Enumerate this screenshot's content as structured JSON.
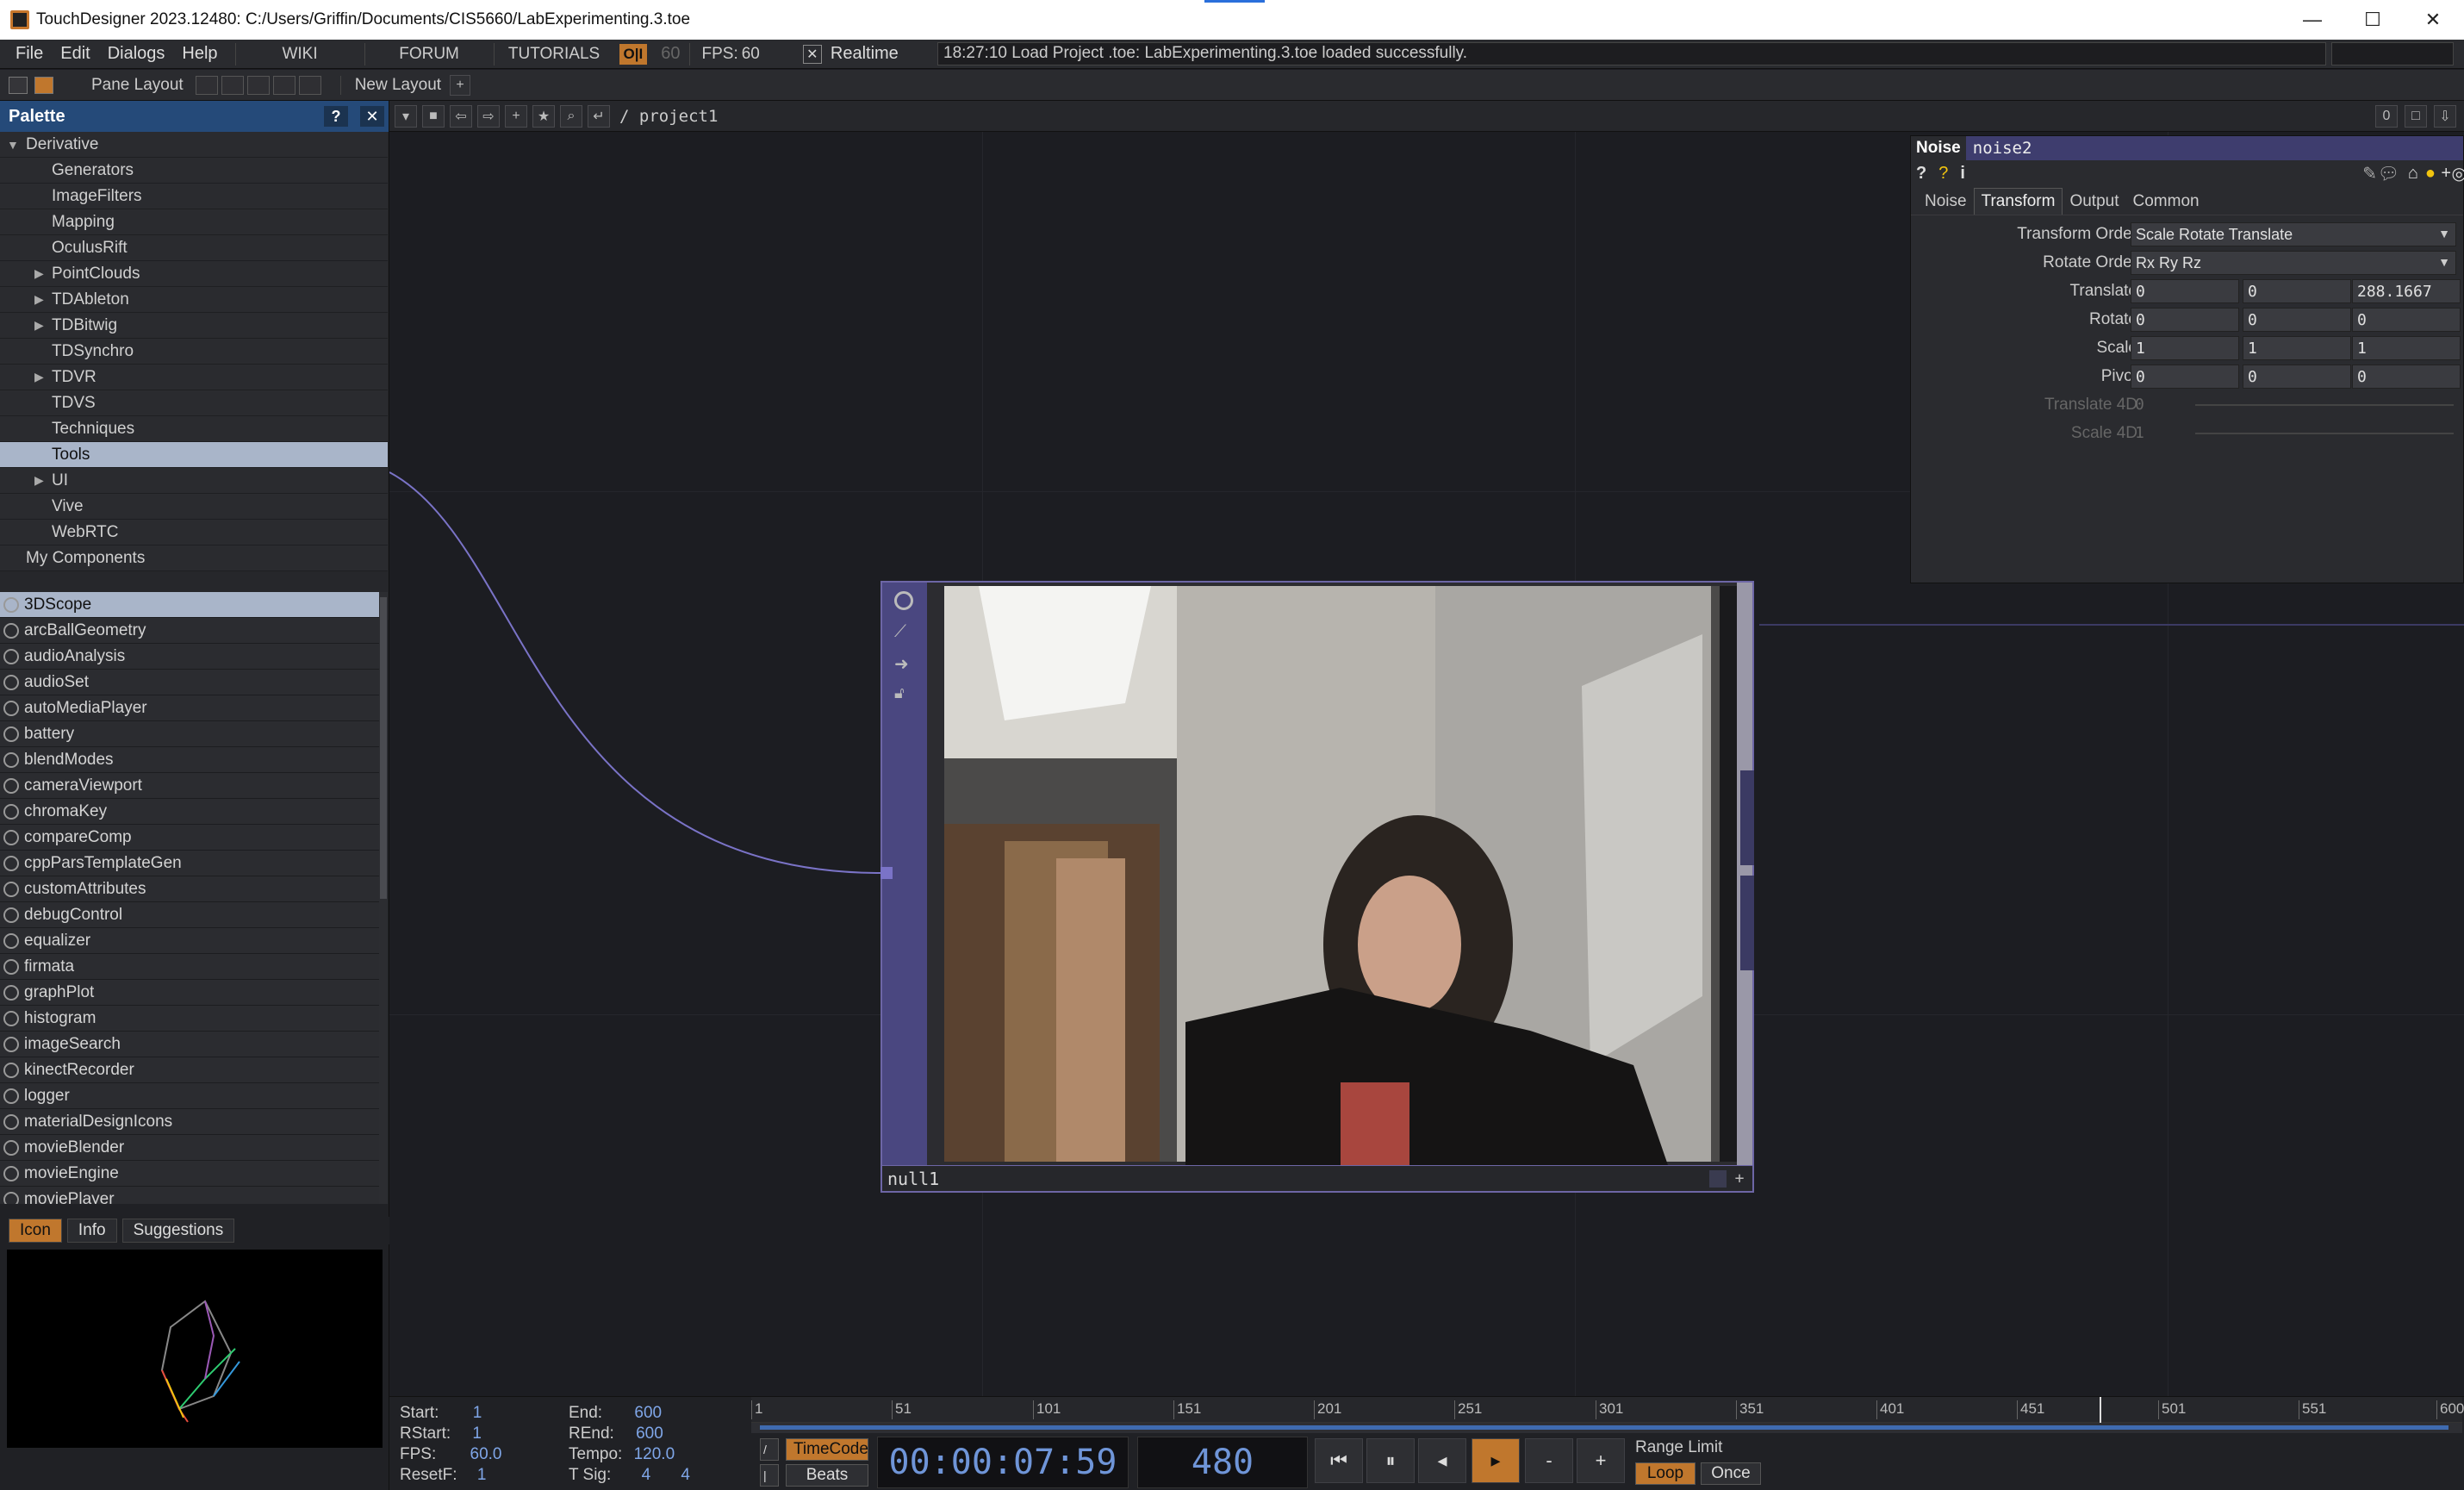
{
  "window": {
    "title": "TouchDesigner 2023.12480: C:/Users/Griffin/Documents/CIS5660/LabExperimenting.3.toe",
    "minimize": "—",
    "maximize": "☐",
    "close": "✕"
  },
  "menu": {
    "items": [
      "File",
      "Edit",
      "Dialogs",
      "Help"
    ],
    "wiki": "WIKI",
    "forum": "FORUM",
    "tutorials": "TUTORIALS",
    "oi": "O|I",
    "fps_cap": "60",
    "fps_label": "FPS:",
    "fps_value": "60",
    "realtime_check": "✕",
    "realtime": "Realtime",
    "status": "18:27:10 Load Project .toe: LabExperimenting.3.toe loaded successfully."
  },
  "toolbar2": {
    "pane_layout": "Pane Layout",
    "new_layout": "New Layout",
    "add": "+"
  },
  "palette": {
    "title": "Palette",
    "help": "?",
    "close": "✕",
    "tree": [
      {
        "label": "Derivative",
        "level": 0,
        "expanded": true
      },
      {
        "label": "Generators",
        "level": 1
      },
      {
        "label": "ImageFilters",
        "level": 1
      },
      {
        "label": "Mapping",
        "level": 1
      },
      {
        "label": "OculusRift",
        "level": 1
      },
      {
        "label": "PointClouds",
        "level": 1,
        "collapsed": true
      },
      {
        "label": "TDAbleton",
        "level": 1,
        "collapsed": true
      },
      {
        "label": "TDBitwig",
        "level": 1,
        "collapsed": true
      },
      {
        "label": "TDSynchro",
        "level": 1
      },
      {
        "label": "TDVR",
        "level": 1,
        "collapsed": true
      },
      {
        "label": "TDVS",
        "level": 1
      },
      {
        "label": "Techniques",
        "level": 1
      },
      {
        "label": "Tools",
        "level": 1,
        "selected": true
      },
      {
        "label": "UI",
        "level": 1,
        "collapsed": true
      },
      {
        "label": "Vive",
        "level": 1
      },
      {
        "label": "WebRTC",
        "level": 1
      },
      {
        "label": "My Components",
        "level": 0
      }
    ],
    "components": [
      "3DScope",
      "arcBallGeometry",
      "audioAnalysis",
      "audioSet",
      "autoMediaPlayer",
      "battery",
      "blendModes",
      "cameraViewport",
      "chromaKey",
      "compareComp",
      "cppParsTemplateGen",
      "customAttributes",
      "debugControl",
      "equalizer",
      "firmata",
      "graphPlot",
      "histogram",
      "imageSearch",
      "kinectRecorder",
      "logger",
      "materialDesignIcons",
      "movieBlender",
      "movieEngine",
      "moviePlayer"
    ],
    "selected_component": "3DScope",
    "tabs": [
      "Icon",
      "Info",
      "Suggestions"
    ],
    "active_tab": "Icon"
  },
  "network": {
    "path": "/ project1",
    "counter": "0",
    "node_name": "null1"
  },
  "params": {
    "op_type": "Noise",
    "op_name": "noise2",
    "tabs": [
      "Noise",
      "Transform",
      "Output",
      "Common"
    ],
    "active_tab": "Transform",
    "rows": [
      {
        "label": "Transform Order",
        "dropdown": "Scale Rotate Translate"
      },
      {
        "label": "Rotate Order",
        "dropdown": "Rx Ry Rz"
      },
      {
        "label": "Translate",
        "values": [
          "0",
          "0",
          "288.1667"
        ]
      },
      {
        "label": "Rotate",
        "values": [
          "0",
          "0",
          "0"
        ]
      },
      {
        "label": "Scale",
        "values": [
          "1",
          "1",
          "1"
        ]
      },
      {
        "label": "Pivot",
        "values": [
          "0",
          "0",
          "0"
        ]
      },
      {
        "label": "Translate 4D",
        "values": [
          "0"
        ],
        "disabled": true
      },
      {
        "label": "Scale 4D",
        "values": [
          "1"
        ],
        "disabled": true
      }
    ]
  },
  "timeline": {
    "start_label": "Start:",
    "start": "1",
    "end_label": "End:",
    "end": "600",
    "rstart_label": "RStart:",
    "rstart": "1",
    "rend_label": "REnd:",
    "rend": "600",
    "fps_label": "FPS:",
    "fps": "60.0",
    "tempo_label": "Tempo:",
    "tempo": "120.0",
    "resetf_label": "ResetF:",
    "resetf": "1",
    "tsig_label": "T Sig:",
    "tsig_a": "4",
    "tsig_b": "4",
    "ticks": [
      "1",
      "51",
      "101",
      "151",
      "201",
      "251",
      "301",
      "351",
      "401",
      "451",
      "501",
      "551",
      "600"
    ],
    "timecode_btn": "TimeCode",
    "beats_btn": "Beats",
    "timecode": "00:00:07:59",
    "frame": "480",
    "range_limit": "Range Limit",
    "loop": "Loop",
    "once": "Once",
    "current_frame_fraction": 0.8
  },
  "colors": {
    "accent_orange": "#c0772d",
    "palette_header": "#254a79",
    "node_purple": "#3b3a63",
    "link_line": "#7a73c7",
    "lcd_blue": "#6f95d8"
  }
}
